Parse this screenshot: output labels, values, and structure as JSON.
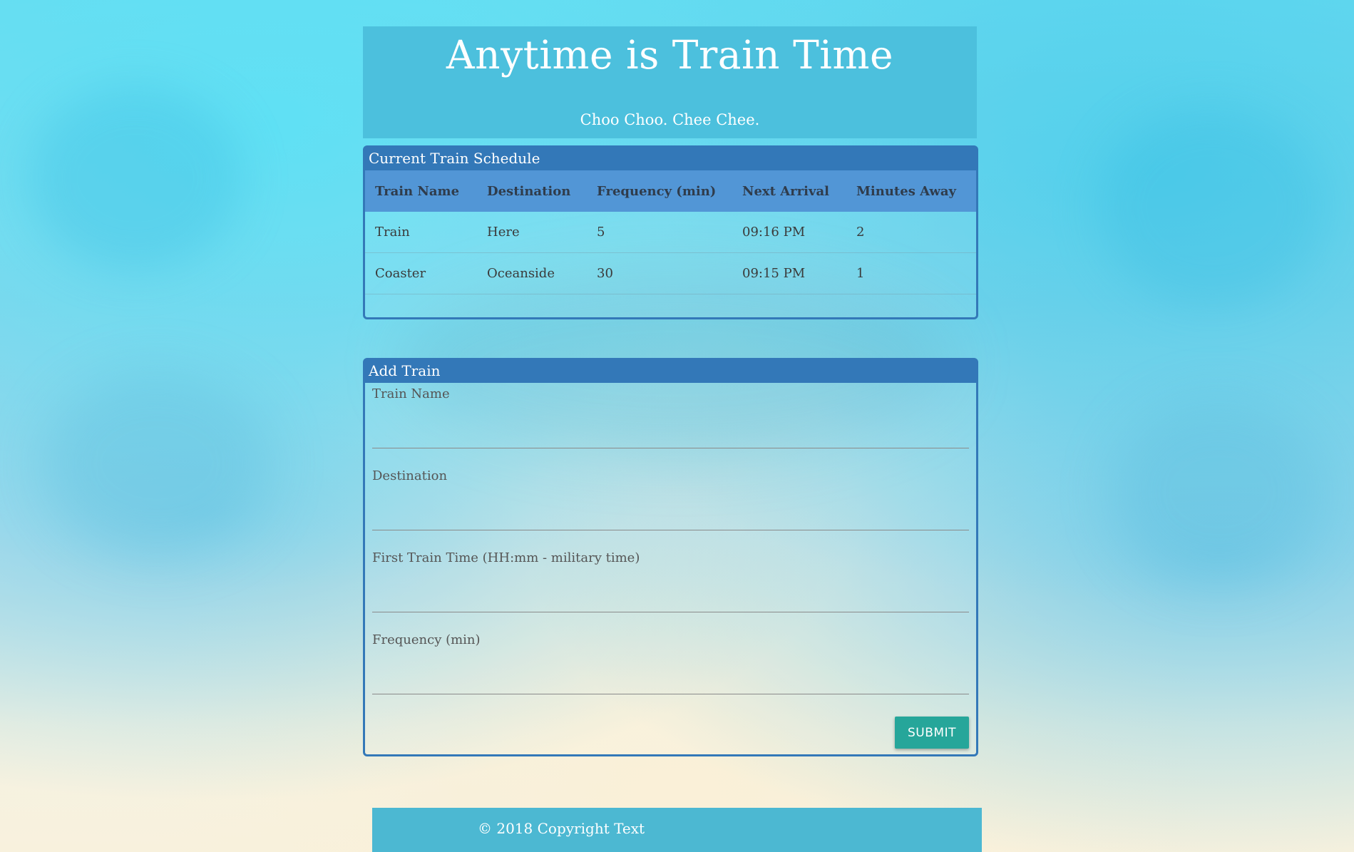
{
  "header": {
    "title": "Anytime is Train Time",
    "tagline": "Choo Choo. Chee Chee."
  },
  "schedule": {
    "heading": "Current Train Schedule",
    "columns": [
      "Train Name",
      "Destination",
      "Frequency (min)",
      "Next Arrival",
      "Minutes Away"
    ],
    "rows": [
      [
        "Train",
        "Here",
        "5",
        "09:16 PM",
        "2"
      ],
      [
        "Coaster",
        "Oceanside",
        "30",
        "09:15 PM",
        "1"
      ]
    ]
  },
  "add_train": {
    "heading": "Add Train",
    "fields": [
      {
        "label": "Train Name",
        "value": ""
      },
      {
        "label": "Destination",
        "value": ""
      },
      {
        "label": "First Train Time (HH:mm - military time)",
        "value": ""
      },
      {
        "label": "Frequency (min)",
        "value": ""
      }
    ],
    "submit_label": "SUBMIT"
  },
  "footer": {
    "copyright": "© 2018 Copyright Text"
  },
  "colors": {
    "header_bg": "#4cc0dd",
    "panel_border": "#3378b8",
    "table_header_bg": "#5296d6",
    "submit_bg": "#26a69a",
    "footer_bg": "#4cb8d2"
  }
}
